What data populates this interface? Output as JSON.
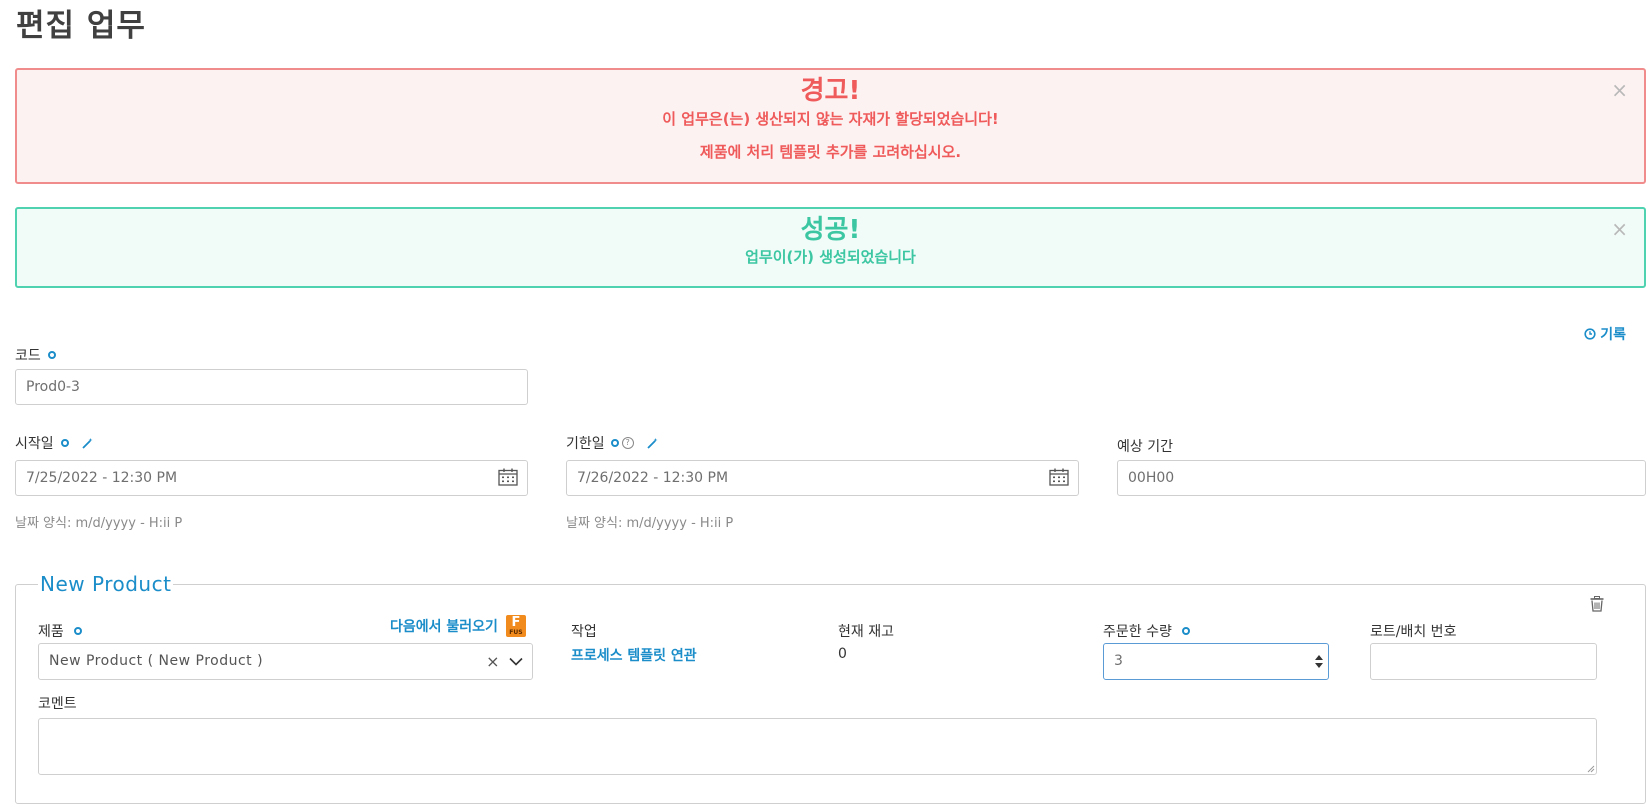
{
  "page": {
    "title": "편집 업무"
  },
  "alerts": {
    "warning": {
      "title": "경고!",
      "line1": "이 업무은(는) 생산되지 않는 자재가 할당되었습니다!",
      "line2": "제품에 처리 템플릿 추가를 고려하십시오.",
      "close": "×"
    },
    "success": {
      "title": "성공!",
      "line1": "업무이(가) 생성되었습니다",
      "close": "×"
    }
  },
  "history": {
    "label": "기록",
    "icon": "clock-icon"
  },
  "form": {
    "code": {
      "label": "코드",
      "value": "Prod0-3"
    },
    "start_date": {
      "label": "시작일",
      "value": "7/25/2022 - 12:30 PM",
      "hint": "날짜 양식: m/d/yyyy - H:ii P"
    },
    "due_date": {
      "label": "기한일",
      "help": "?",
      "value": "7/26/2022 - 12:30 PM",
      "hint": "날짜 양식: m/d/yyyy - H:ii P"
    },
    "duration": {
      "label": "예상 기간",
      "value": "00H00"
    }
  },
  "product_section": {
    "legend": "New Product",
    "product": {
      "label": "제품",
      "load_link": "다음에서 불러오기",
      "badge": "F",
      "badge_sub": "FUS",
      "value": "New Product ( New Product )",
      "clear": "×"
    },
    "operation": {
      "label": "작업",
      "link": "프로세스 템플릿 연관"
    },
    "stock": {
      "label": "현재 재고",
      "value": "0"
    },
    "ordered_qty": {
      "label": "주문한 수량",
      "value": "3"
    },
    "lot": {
      "label": "로트/배치 번호",
      "value": ""
    },
    "comment": {
      "label": "코멘트",
      "value": ""
    }
  },
  "colors": {
    "accent": "#1b8dc9",
    "danger": "#ef5b5b",
    "success": "#3cc7a2"
  }
}
